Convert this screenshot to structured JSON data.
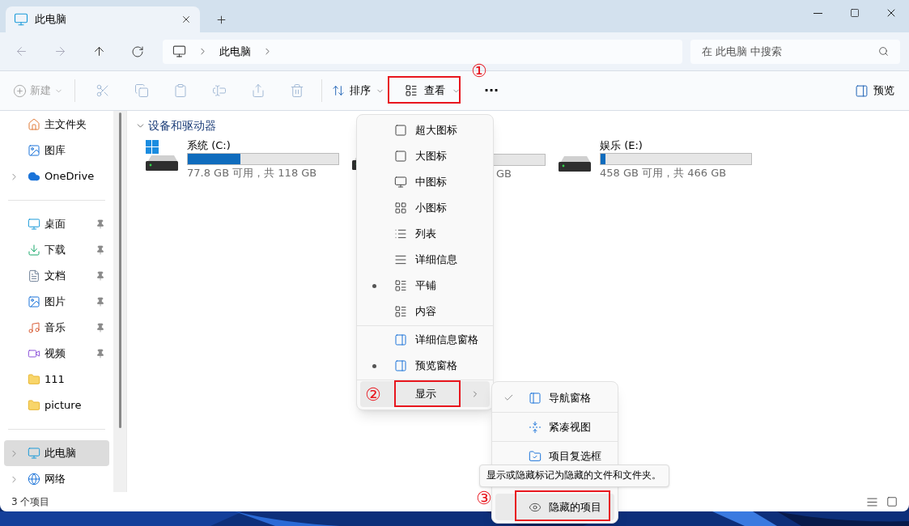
{
  "tabs": [
    {
      "title": "此电脑",
      "selected": true
    }
  ],
  "address": {
    "crumbs": [
      "此电脑"
    ]
  },
  "search": {
    "placeholder": "在 此电脑 中搜索"
  },
  "toolbar": {
    "new": {
      "label": "新建",
      "disabled": true
    },
    "sort": "排序",
    "view": "查看",
    "more": "···",
    "preview": "预览"
  },
  "sidebar": {
    "sections": [
      [
        {
          "label": "主文件夹",
          "expandable": false,
          "pinned": false,
          "selected": false
        },
        {
          "label": "图库",
          "expandable": false,
          "pinned": false,
          "selected": false
        },
        {
          "label": "OneDrive",
          "expandable": true,
          "pinned": false,
          "selected": false
        }
      ],
      [
        {
          "label": "桌面",
          "expandable": false,
          "pinned": true,
          "selected": false
        },
        {
          "label": "下载",
          "expandable": false,
          "pinned": true,
          "selected": false
        },
        {
          "label": "文档",
          "expandable": false,
          "pinned": true,
          "selected": false
        },
        {
          "label": "图片",
          "expandable": false,
          "pinned": true,
          "selected": false
        },
        {
          "label": "音乐",
          "expandable": false,
          "pinned": true,
          "selected": false
        },
        {
          "label": "视频",
          "expandable": false,
          "pinned": true,
          "selected": false
        },
        {
          "label": "111",
          "expandable": false,
          "pinned": false,
          "selected": false
        },
        {
          "label": "picture",
          "expandable": false,
          "pinned": false,
          "selected": false
        }
      ],
      [
        {
          "label": "此电脑",
          "expandable": true,
          "pinned": false,
          "selected": true
        },
        {
          "label": "网络",
          "expandable": true,
          "pinned": false,
          "selected": false
        }
      ]
    ]
  },
  "section": {
    "title": "设备和驱动器",
    "expanded": true
  },
  "drives": [
    {
      "kind": "system",
      "name": "系统 (C:)",
      "level": 0.35,
      "usage": "77.8 GB 可用，共 118 GB"
    },
    {
      "kind": "covered",
      "usage": "GB"
    },
    {
      "kind": "data",
      "name": "娱乐 (E:)",
      "level": 0.03,
      "usage": "458 GB 可用，共 466 GB"
    }
  ],
  "view_menu": {
    "groups": [
      [
        {
          "label": "超大图标",
          "selected": false
        },
        {
          "label": "大图标",
          "selected": false
        },
        {
          "label": "中图标",
          "selected": false
        },
        {
          "label": "小图标",
          "selected": false
        },
        {
          "label": "列表",
          "selected": false
        },
        {
          "label": "详细信息",
          "selected": false
        },
        {
          "label": "平铺",
          "selected": true
        },
        {
          "label": "内容",
          "selected": false
        }
      ],
      [
        {
          "label": "详细信息窗格",
          "selected": false
        },
        {
          "label": "预览窗格",
          "selected": true
        }
      ],
      [
        {
          "label": "显示",
          "hovered": true,
          "submenu": true
        }
      ]
    ]
  },
  "show_menu": {
    "items": [
      {
        "label": "导航窗格",
        "checked": true,
        "hovered": false
      },
      {
        "label": "紧凑视图",
        "checked": false,
        "hovered": false
      },
      {
        "label": "项目复选框",
        "checked": false,
        "hovered": false
      },
      {
        "label": "隐藏的项目",
        "checked": false,
        "hovered": true
      }
    ]
  },
  "tooltip": "显示或隐藏标记为隐藏的文件和文件夹。",
  "status": {
    "count": "3 个项目"
  },
  "annotations": [
    {
      "number": "①"
    },
    {
      "number": "②"
    },
    {
      "number": "③"
    }
  ]
}
